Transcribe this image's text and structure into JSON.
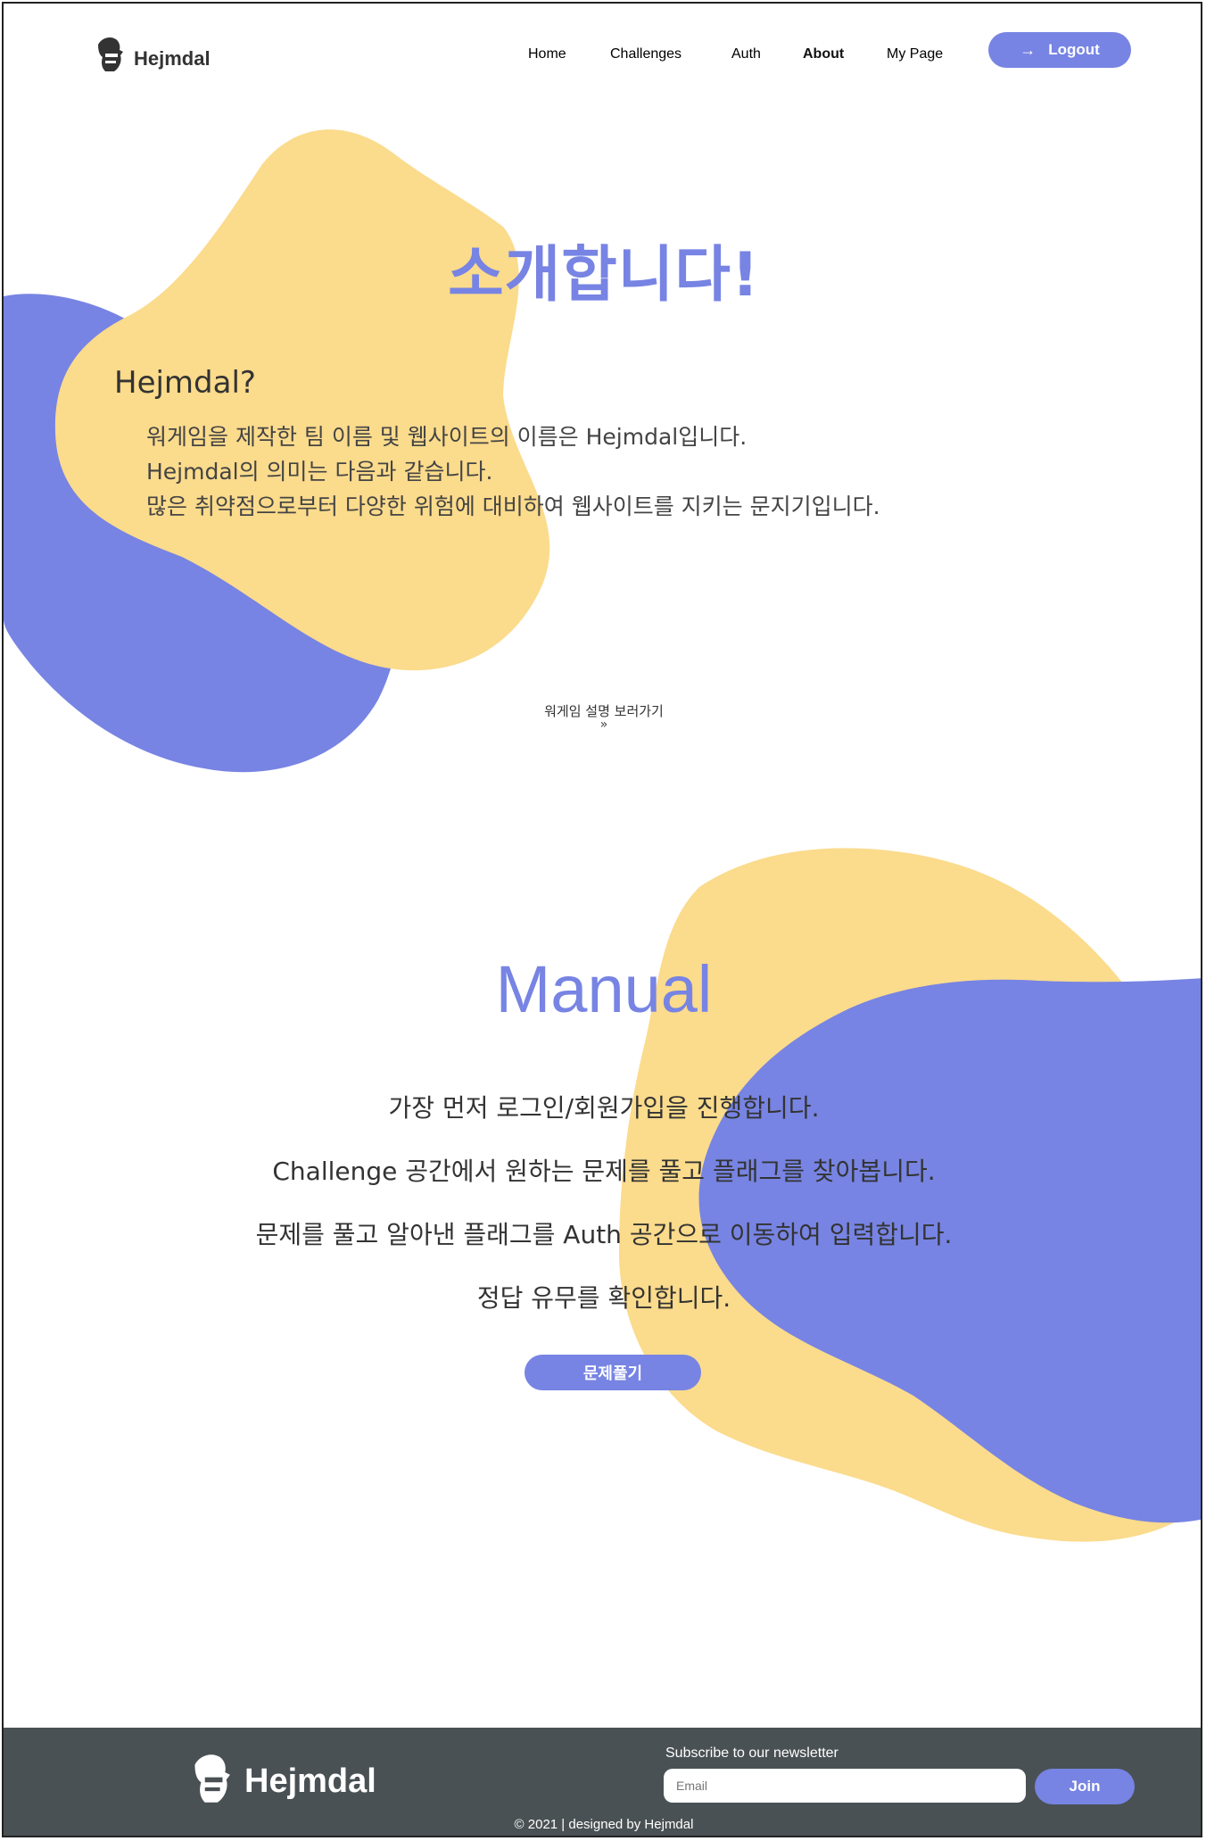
{
  "colors": {
    "accent": "#7784e3",
    "blob_yellow": "#fbdb8c",
    "footer_bg": "#4a5154"
  },
  "header": {
    "logo_text": "Hejmdal",
    "nav": [
      {
        "label": "Home",
        "active": false
      },
      {
        "label": "Challenges",
        "active": false
      },
      {
        "label": "Auth",
        "active": false
      },
      {
        "label": "About",
        "active": true
      },
      {
        "label": "My Page",
        "active": false
      }
    ],
    "logout_label": "Logout",
    "logout_icon": "arrow-right-icon"
  },
  "intro": {
    "title": "소개합니다!",
    "heading": "Hejmdal?",
    "lines": [
      "워게임을 제작한 팀 이름 및 웹사이트의 이름은 Hejmdal입니다.",
      "Hejmdal의 의미는 다음과 같습니다.",
      "많은 취약점으로부터 다양한 위험에 대비하여 웹사이트를 지키는 문지기입니다."
    ],
    "scroll_hint": "워게임 설명 보러가기",
    "scroll_icon": "double-chevron-down-icon"
  },
  "manual": {
    "title": "Manual",
    "lines": [
      "가장 먼저 로그인/회원가입을 진행합니다.",
      "Challenge 공간에서 원하는 문제를 풀고 플래그를 찾아봅니다.",
      "문제를 풀고 알아낸 플래그를 Auth 공간으로 이동하여 입력합니다.",
      "정답 유무를 확인합니다."
    ],
    "button_label": "문제풀기"
  },
  "footer": {
    "logo_text": "Hejmdal",
    "newsletter_label": "Subscribe to our newsletter",
    "email_placeholder": "Email",
    "join_label": "Join",
    "copyright": "© 2021 | designed by Hejmdal"
  }
}
